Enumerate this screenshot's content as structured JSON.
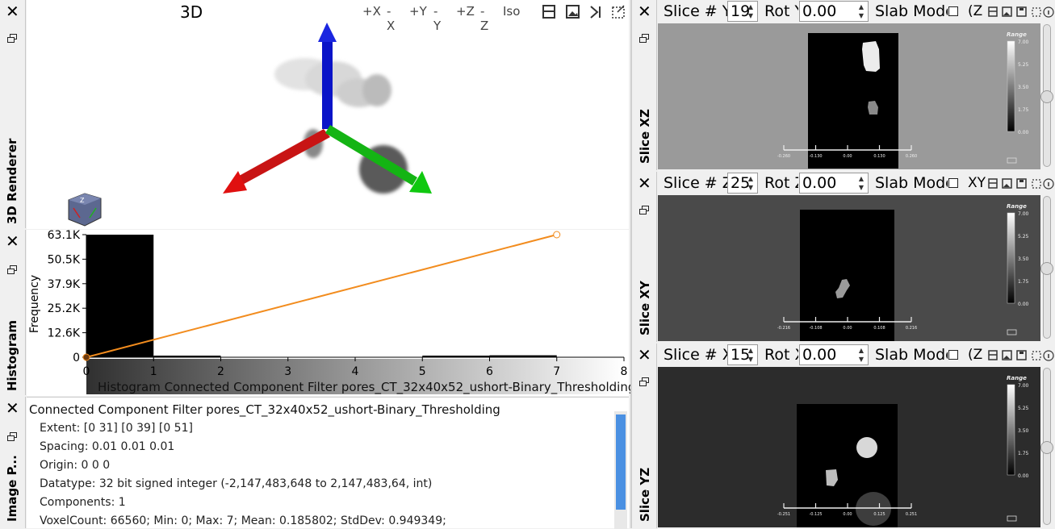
{
  "renderer": {
    "tab_label": "3D Renderer",
    "title": "3D",
    "toolbar": [
      "+X",
      "-X",
      "+Y",
      "-Y",
      "+Z",
      "-Z",
      "Iso"
    ]
  },
  "histogram": {
    "tab_label": "Histogram",
    "caption": "Histogram Connected Component Filter pores_CT_32x40x52_ushort-Binary_Thresholding"
  },
  "chart_data": {
    "type": "bar",
    "ylabel": "Frequency",
    "x_ticks": [
      "0",
      "1",
      "2",
      "3",
      "4",
      "5",
      "6",
      "7",
      "8"
    ],
    "y_ticks": [
      "63.1K",
      "50.5K",
      "37.9K",
      "25.2K",
      "12.6K",
      "0"
    ],
    "xlim": [
      0,
      8
    ],
    "ylim": [
      0,
      63100
    ],
    "bins": [
      {
        "x0": 0,
        "x1": 1,
        "value": 63100
      },
      {
        "x0": 1,
        "x1": 2,
        "value": 800
      },
      {
        "x0": 2,
        "x1": 3,
        "value": 0
      },
      {
        "x0": 3,
        "x1": 4,
        "value": 0
      },
      {
        "x0": 4,
        "x1": 5,
        "value": 0
      },
      {
        "x0": 5,
        "x1": 6,
        "value": 250
      },
      {
        "x0": 6,
        "x1": 7,
        "value": 1000
      }
    ],
    "transfer_line": {
      "x": [
        0,
        7
      ],
      "y": [
        0,
        63100
      ],
      "color": "#f28c1e"
    }
  },
  "info": {
    "tab_label": "Image P...",
    "title": "Connected Component Filter pores_CT_32x40x52_ushort-Binary_Thresholding",
    "lines": [
      "Extent: [0 31]  [0 39]  [0 51]",
      "Spacing:  0.01  0.01  0.01",
      "Origin: 0 0 0",
      "Datatype: 32 bit signed integer (-2,147,483,648 to 2,147,483,64, int)",
      "Components: 1",
      "VoxelCount: 66560;  Min: 0;  Max: 7;  Mean: 0.185802;  StdDev: 0.949349;"
    ]
  },
  "slices": [
    {
      "tab_label": "Slice XZ",
      "slice_label": "Slice # Y",
      "slice_value": "19",
      "rot_label": "Rot Y",
      "rot_value": "0.00",
      "slab_label": "Slab Mode",
      "axis_glyph": "(Z",
      "bg": "#9a9a9a",
      "colorbar": {
        "title": "Range",
        "ticks": [
          "7.00",
          "5.25",
          "3.50",
          "1.75",
          "0.00"
        ]
      },
      "ruler": [
        "-0.260",
        "-0.130",
        "0.00",
        "0.130",
        "0.260"
      ]
    },
    {
      "tab_label": "Slice XY",
      "slice_label": "Slice # Z",
      "slice_value": "25",
      "rot_label": "Rot Z",
      "rot_value": "0.00",
      "slab_label": "Slab Mode",
      "axis_glyph": "XY",
      "bg": "#4a4a4a",
      "colorbar": {
        "title": "Range",
        "ticks": [
          "7.00",
          "5.25",
          "3.50",
          "1.75",
          "0.00"
        ]
      },
      "ruler": [
        "-0.216",
        "-0.108",
        "0.00",
        "0.108",
        "0.216"
      ]
    },
    {
      "tab_label": "Slice YZ",
      "slice_label": "Slice # X",
      "slice_value": "15",
      "rot_label": "Rot X",
      "rot_value": "0.00",
      "slab_label": "Slab Mode",
      "axis_glyph": "(Z",
      "bg": "#2c2c2c",
      "colorbar": {
        "title": "Range",
        "ticks": [
          "7.00",
          "5.25",
          "3.50",
          "1.75",
          "0.00"
        ]
      },
      "ruler": [
        "-0.251",
        "-0.125",
        "0.00",
        "0.125",
        "0.251"
      ]
    }
  ]
}
